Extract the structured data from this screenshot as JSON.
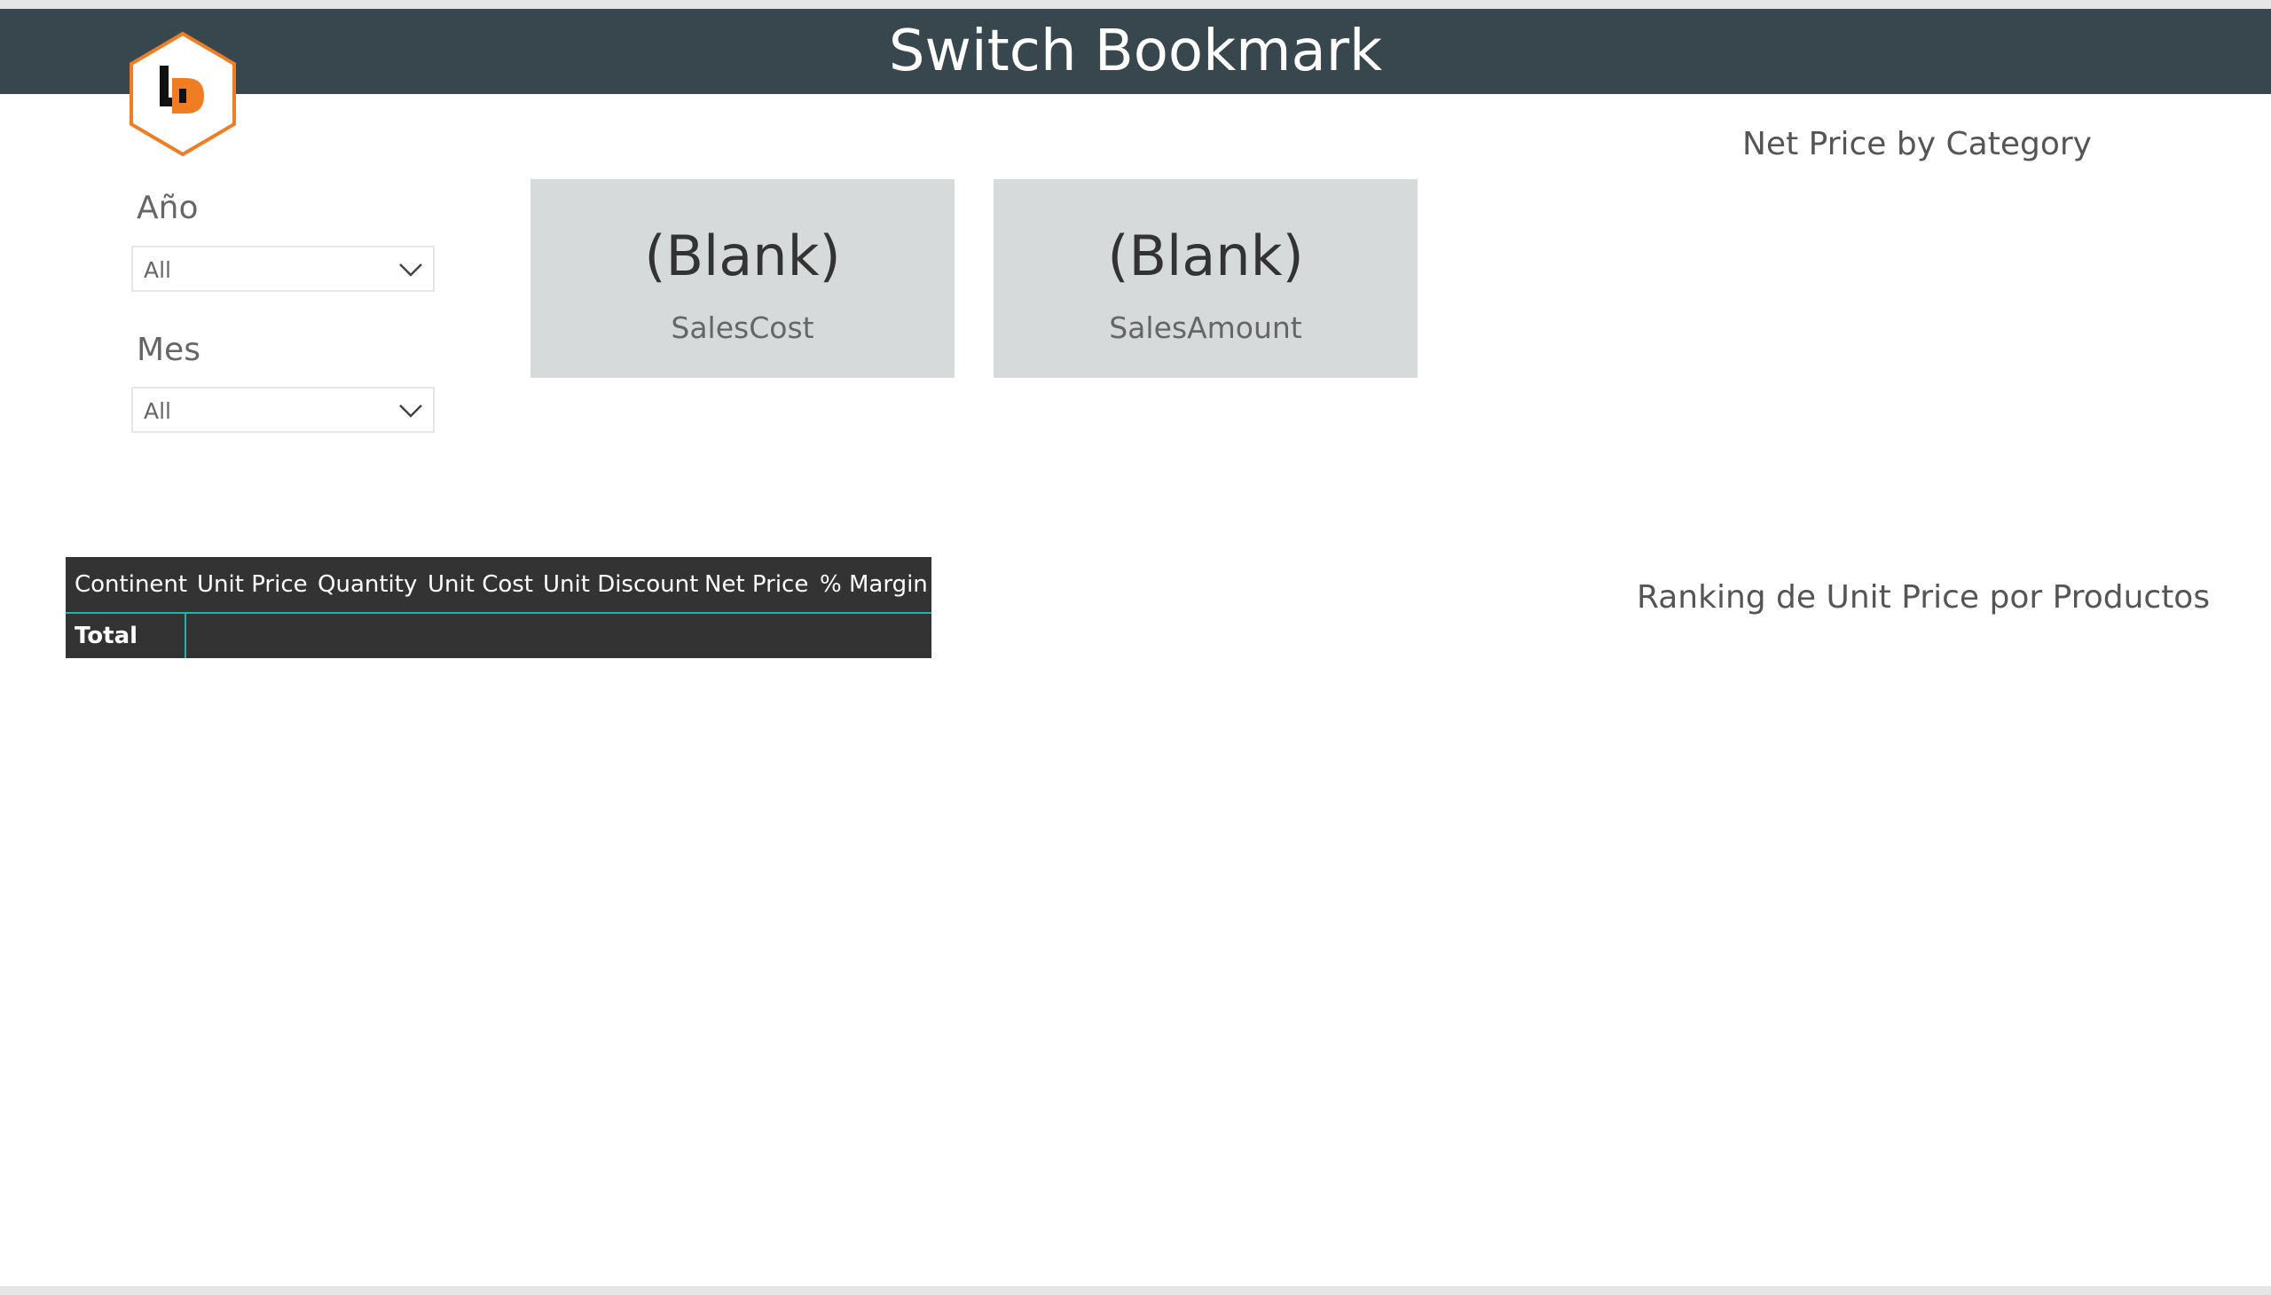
{
  "header": {
    "title": "Switch Bookmark",
    "background": "#38474d"
  },
  "logo": {
    "icon": "ld-hexagon-logo",
    "accent": "#f07d22"
  },
  "slicers": [
    {
      "label": "Año",
      "value": "All"
    },
    {
      "label": "Mes",
      "value": "All"
    }
  ],
  "cards": [
    {
      "value": "(Blank)",
      "label": "SalesCost"
    },
    {
      "value": "(Blank)",
      "label": "SalesAmount"
    }
  ],
  "charts": {
    "net_price_title": "Net Price by Category",
    "ranking_title": "Ranking de Unit Price por Productos"
  },
  "matrix": {
    "columns": [
      "Continent",
      "Unit Price",
      "Quantity",
      "Unit Cost",
      "Unit Discount",
      "Net Price",
      "% Margin"
    ],
    "total_label": "Total",
    "accent": "#1ab5b0"
  }
}
